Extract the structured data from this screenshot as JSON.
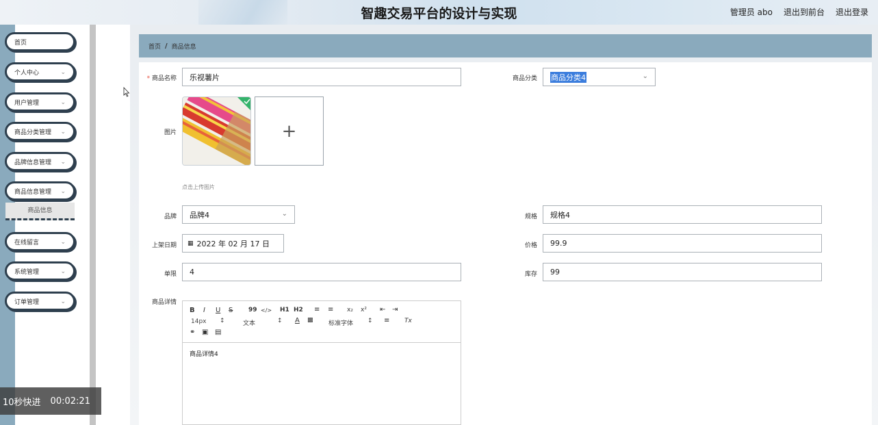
{
  "header": {
    "title": "智趣交易平台的设计与实现",
    "user": "管理员 abo",
    "to_front": "退出到前台",
    "logout": "退出登录"
  },
  "sidebar": {
    "items": [
      {
        "label": "首页"
      },
      {
        "label": "个人中心"
      },
      {
        "label": "用户管理"
      },
      {
        "label": "商品分类管理"
      },
      {
        "label": "品牌信息管理"
      },
      {
        "label": "商品信息管理"
      },
      {
        "label": "在线留言"
      },
      {
        "label": "系统管理"
      },
      {
        "label": "订单管理"
      }
    ],
    "active_sub": "商品信息"
  },
  "breadcrumb": {
    "home": "首页",
    "sep": "/",
    "current": "商品信息"
  },
  "form": {
    "name_label": "商品名称",
    "name_value": "乐视薯片",
    "category_label": "商品分类",
    "category_value": "商品分类4",
    "image_label": "图片",
    "upload_hint": "点击上传图片",
    "upload_plus": "+",
    "brand_label": "品牌",
    "brand_value": "品牌4",
    "spec_label": "规格",
    "spec_value": "规格4",
    "date_label": "上架日期",
    "date_value": "2022 年 02 月 17 日",
    "price_label": "价格",
    "price_value": "99.9",
    "limit_label": "单限",
    "limit_value": "4",
    "stock_label": "库存",
    "stock_value": "99",
    "detail_label": "商品详情",
    "detail_value": "商品详情4"
  },
  "editor": {
    "bold": "B",
    "italic": "I",
    "underline": "U",
    "strike": "S",
    "quote": "99",
    "code": "</>",
    "h1": "H1",
    "h2": "H2",
    "sub": "x₂",
    "sup": "x²",
    "size": "14px",
    "text": "文本",
    "font": "标准字体",
    "clear": "Tx"
  },
  "overlay": {
    "speed": "10秒快进",
    "time": "00:02:21"
  }
}
